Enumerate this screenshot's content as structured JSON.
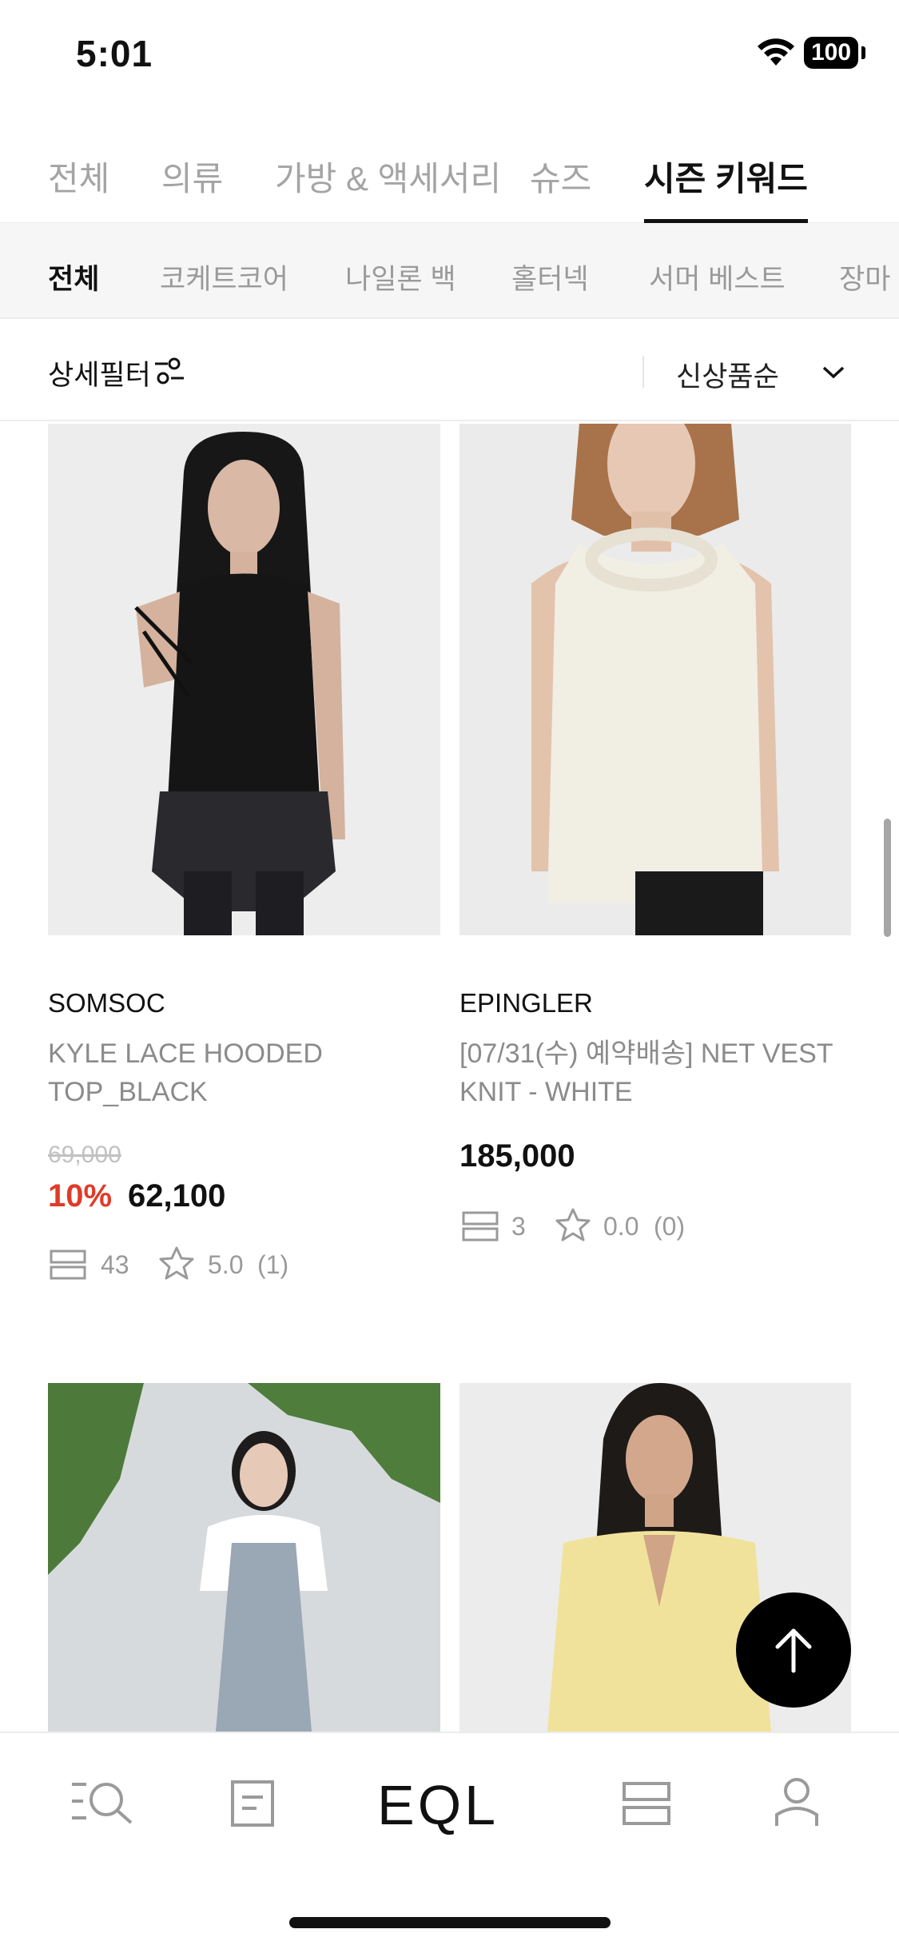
{
  "status_bar": {
    "time": "5:01",
    "battery": "100"
  },
  "category_tabs": [
    {
      "label": "전체",
      "active": false
    },
    {
      "label": "의류",
      "active": false
    },
    {
      "label": "가방 & 액세서리",
      "active": false
    },
    {
      "label": "슈즈",
      "active": false
    },
    {
      "label": "시즌 키워드",
      "active": true
    }
  ],
  "sub_tabs": [
    {
      "label": "전체",
      "active": true
    },
    {
      "label": "코케트코어",
      "active": false
    },
    {
      "label": "나일론 백",
      "active": false
    },
    {
      "label": "홀터넥",
      "active": false
    },
    {
      "label": "서머 베스트",
      "active": false
    },
    {
      "label": "장마 슈즈",
      "active": false
    }
  ],
  "filter": {
    "label": "상세필터",
    "sort_label": "신상품순"
  },
  "products": [
    {
      "brand": "SOMSOC",
      "name": "KYLE LACE HOODED TOP_BLACK",
      "original_price": "69,000",
      "discount": "10%",
      "price": "62,100",
      "likes": "43",
      "rating": "5.0",
      "review_count": "(1)"
    },
    {
      "brand": "EPINGLER",
      "name": "[07/31(수) 예약배송]  NET VEST KNIT - WHITE",
      "price": "185,000",
      "likes": "3",
      "rating": "0.0",
      "review_count": "(0)"
    }
  ],
  "bottom_nav": {
    "logo": "EQL",
    "items": [
      "search-menu-icon",
      "document-icon",
      "eql-logo",
      "shelf-icon",
      "profile-icon"
    ]
  },
  "colors": {
    "accent_discount": "#e03b2a",
    "text": "#111111",
    "muted": "#9a9a9a"
  }
}
